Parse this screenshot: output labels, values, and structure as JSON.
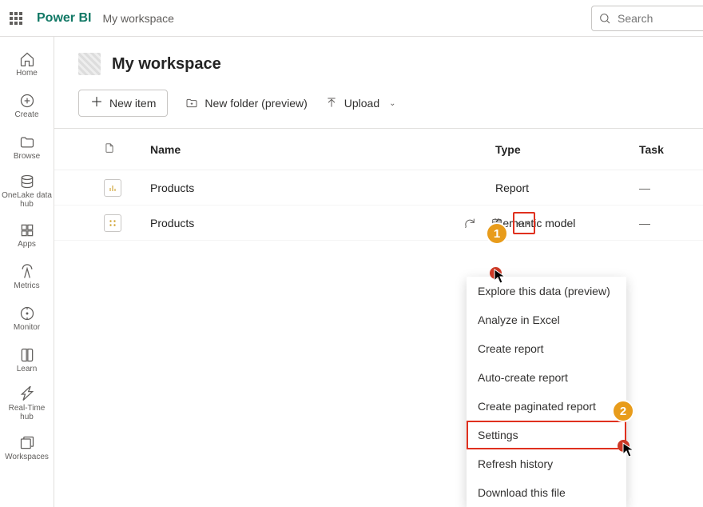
{
  "topbar": {
    "brand": "Power BI",
    "breadcrumb": "My workspace",
    "search_placeholder": "Search"
  },
  "rail": {
    "home": "Home",
    "create": "Create",
    "browse": "Browse",
    "onelake": "OneLake data hub",
    "apps": "Apps",
    "metrics": "Metrics",
    "monitor": "Monitor",
    "learn": "Learn",
    "realtime": "Real-Time hub",
    "workspaces": "Workspaces"
  },
  "workspace": {
    "title": "My workspace"
  },
  "toolbar": {
    "new_item": "New item",
    "new_folder": "New folder (preview)",
    "upload": "Upload"
  },
  "table": {
    "headers": {
      "name": "Name",
      "type": "Type",
      "task": "Task"
    },
    "rows": [
      {
        "name": "Products",
        "type": "Report",
        "task": "—"
      },
      {
        "name": "Products",
        "type": "Semantic model",
        "task": "—"
      }
    ]
  },
  "context_menu": {
    "items": [
      "Explore this data (preview)",
      "Analyze in Excel",
      "Create report",
      "Auto-create report",
      "Create paginated report",
      "Settings",
      "Refresh history",
      "Download this file"
    ]
  },
  "annotations": {
    "step1": "1",
    "step2": "2"
  }
}
